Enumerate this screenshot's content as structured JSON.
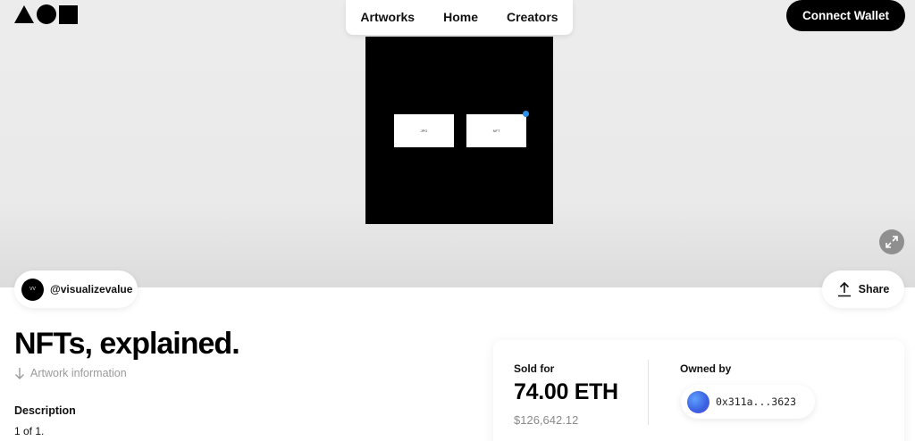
{
  "header": {
    "nav": [
      {
        "label": "Artworks"
      },
      {
        "label": "Home"
      },
      {
        "label": "Creators"
      }
    ],
    "connect_wallet_label": "Connect Wallet"
  },
  "artwork": {
    "box_left_text": "JPG",
    "box_right_text": "NFT",
    "dot_color": "#2f8fe6"
  },
  "creator": {
    "avatar_text": "VV",
    "handle": "@visualizevalue"
  },
  "share_label": "Share",
  "title": "NFTs, explained.",
  "artwork_info_label": "Artwork information",
  "description": {
    "label": "Description",
    "text": "1 of 1."
  },
  "sale": {
    "sold_label": "Sold for",
    "price": "74.00 ETH",
    "usd": "$126,642.12",
    "owned_label": "Owned by",
    "owner_address": "0x311a...3623"
  }
}
